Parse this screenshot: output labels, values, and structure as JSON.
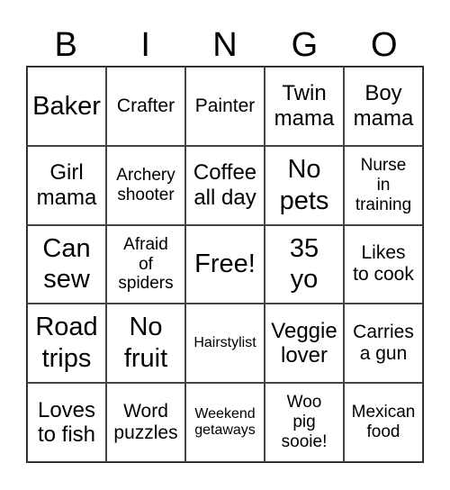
{
  "header": [
    "B",
    "I",
    "N",
    "G",
    "O"
  ],
  "cells": [
    [
      "Baker",
      "Crafter",
      "Painter",
      "Twin\nmama",
      "Boy\nmama"
    ],
    [
      "Girl\nmama",
      "Archery\nshooter",
      "Coffee\nall day",
      "No\npets",
      "Nurse\nin\ntraining"
    ],
    [
      "Can\nsew",
      "Afraid\nof\nspiders",
      "Free!",
      "35\nyo",
      "Likes\nto cook"
    ],
    [
      "Road\ntrips",
      "No\nfruit",
      "Hairstylist",
      "Veggie\nlover",
      "Carries\na gun"
    ],
    [
      "Loves\nto fish",
      "Word\npuzzles",
      "Weekend\ngetaways",
      "Woo\npig\nsooie!",
      "Mexican\nfood"
    ]
  ]
}
